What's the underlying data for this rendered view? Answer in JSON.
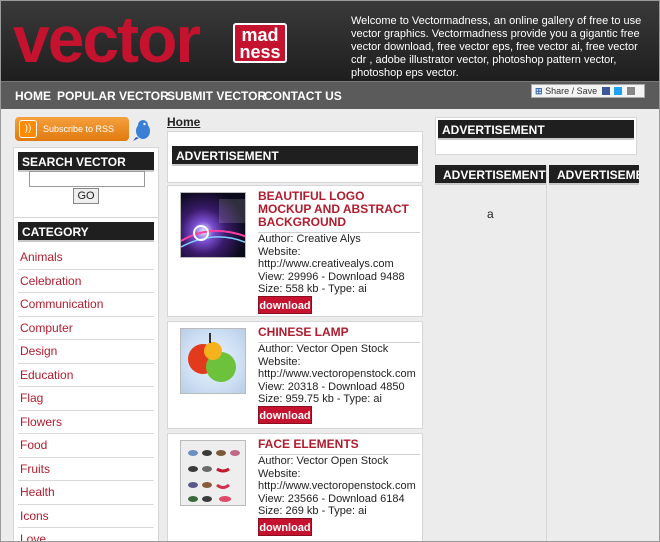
{
  "header": {
    "logo_text_main": "vector",
    "logo_text_badge_line1": "mad",
    "logo_text_badge_line2": "ness",
    "welcome": "Welcome to Vectormadness, an online gallery of free to use vector graphics. Vectormadness provide you a gigantic free vector download, free vector eps, free vector ai, free vector cdr , adobe illustrator vector, photoshop pattern vector, photoshop eps vector."
  },
  "nav": {
    "items": [
      "HOME",
      "POPULAR VECTOR",
      "SUBMIT VECTOR",
      "CONTACT US"
    ]
  },
  "share": {
    "label": "Share / Save"
  },
  "sidebar": {
    "rss_label": "Subscribe to RSS",
    "search_title": "SEARCH VECTOR",
    "search_value": "",
    "go_label": "GO",
    "category_title": "CATEGORY",
    "categories": [
      "Animals",
      "Celebration",
      "Communication",
      "Computer",
      "Design",
      "Education",
      "Flag",
      "Flowers",
      "Food",
      "Fruits",
      "Health",
      "Icons",
      "Love"
    ]
  },
  "main": {
    "breadcrumb": "Home",
    "ad_title": "ADVERTISEMENT",
    "items": [
      {
        "title": "BEAUTIFUL LOGO MOCKUP AND ABSTRACT BACKGROUND",
        "author": "Author: Creative Alys",
        "website_label": "Website:",
        "website": "http://www.creativealys.com",
        "stats": "View: 29996 - Download 9488",
        "size": "Size: 558 kb - Type: ai",
        "download": "download"
      },
      {
        "title": "CHINESE LAMP",
        "author": "Author: Vector Open Stock",
        "website_label": "Website:",
        "website": "http://www.vectoropenstock.com",
        "stats": "View: 20318 - Download 4850",
        "size": "Size: 959.75 kb - Type: ai",
        "download": "download"
      },
      {
        "title": "FACE ELEMENTS",
        "author": "Author: Vector Open Stock",
        "website_label": "Website:",
        "website": "http://www.vectoropenstock.com",
        "stats": "View: 23566 - Download 6184",
        "size": "Size: 269 kb - Type: ai",
        "download": "download"
      }
    ]
  },
  "right": {
    "ad_title": "ADVERTISEMENT",
    "col1_title": "ADVERTISEMENT",
    "col2_title": "ADVERTISEMENT",
    "col1_text": "a"
  },
  "colors": {
    "accent": "#c4122f",
    "link": "#b01c2e",
    "header_bg": "#2a2a2a",
    "nav_bg": "#5b5b5b"
  }
}
